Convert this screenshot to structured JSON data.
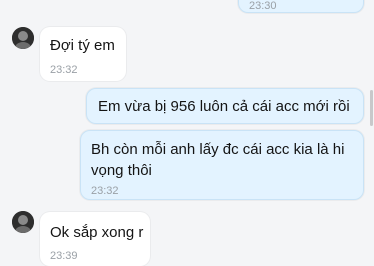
{
  "conversation": {
    "messages": [
      {
        "direction": "outgoing",
        "text": "",
        "time": "23:30"
      },
      {
        "direction": "incoming",
        "text": "Đợi tý em",
        "time": "23:32"
      },
      {
        "direction": "outgoing",
        "text": "Em vừa bị 956 luôn cả cái acc mới rồi",
        "time": ""
      },
      {
        "direction": "outgoing",
        "text": "Bh còn mỗi anh lấy đc cái acc kia là hi vọng thôi",
        "time": "23:32"
      },
      {
        "direction": "incoming",
        "text": "Ok sắp xong r",
        "time": "23:39"
      }
    ]
  },
  "icons": {
    "avatar": "contact-avatar",
    "scrollbar": "scroll-indicator"
  }
}
